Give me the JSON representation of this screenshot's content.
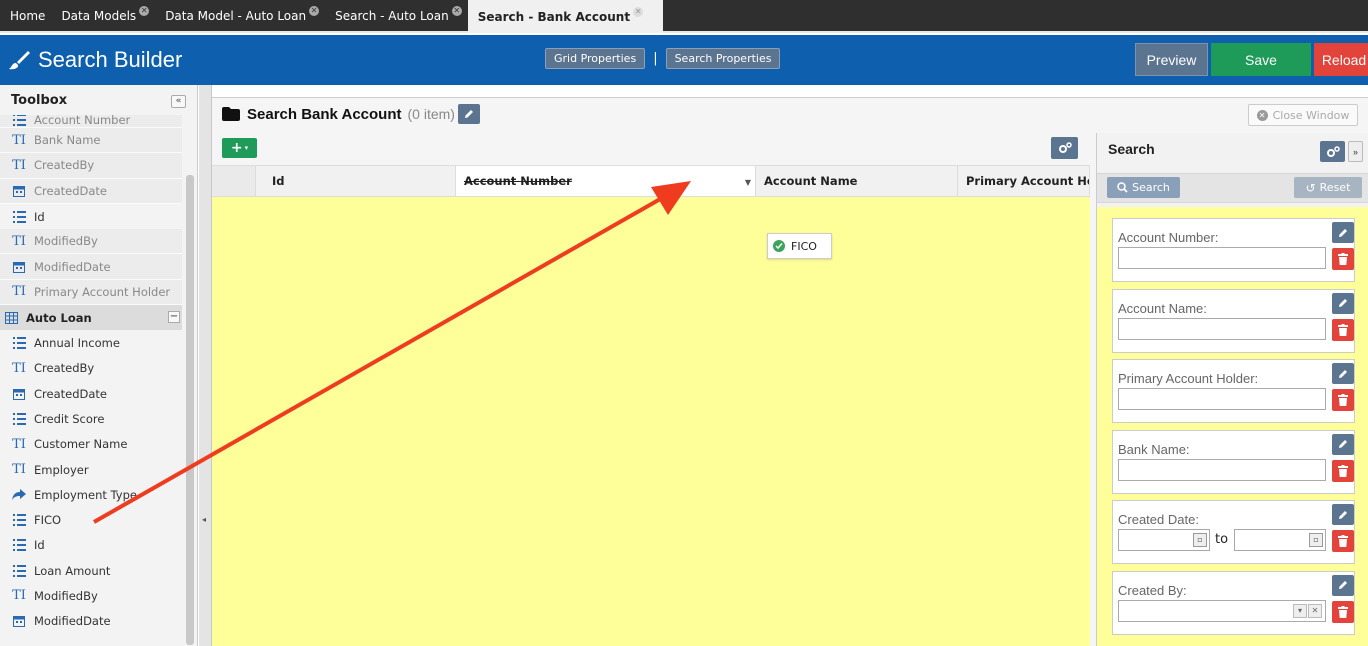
{
  "tabs": [
    {
      "label": "Home",
      "closable": false
    },
    {
      "label": "Data Models",
      "closable": true
    },
    {
      "label": "Data Model - Auto Loan",
      "closable": true
    },
    {
      "label": "Search - Auto Loan",
      "closable": true
    },
    {
      "label": "Search - Bank Account",
      "closable": true,
      "active": true
    }
  ],
  "header": {
    "title": "Search Builder",
    "grid_properties": "Grid Properties",
    "separator": "|",
    "search_properties": "Search Properties",
    "preview": "Preview",
    "save": "Save",
    "reload": "Reload"
  },
  "toolbox": {
    "title": "Toolbox",
    "collapse": "«",
    "items": [
      {
        "label": "Account Number",
        "icon": "list-icon",
        "dim": true
      },
      {
        "label": "Bank Name",
        "icon": "text-icon",
        "dim": true
      },
      {
        "label": "CreatedBy",
        "icon": "text-icon",
        "dim": true
      },
      {
        "label": "CreatedDate",
        "icon": "calendar-icon",
        "dim": true
      },
      {
        "label": "Id",
        "icon": "list-icon",
        "dim": false
      },
      {
        "label": "ModifiedBy",
        "icon": "text-icon",
        "dim": true
      },
      {
        "label": "ModifiedDate",
        "icon": "calendar-icon",
        "dim": true
      },
      {
        "label": "Primary Account Holder",
        "icon": "text-icon",
        "dim": true
      }
    ],
    "group": {
      "label": "Auto Loan",
      "icon": "table-icon",
      "toggle": "−"
    },
    "group_items": [
      {
        "label": "Annual Income",
        "icon": "list-icon"
      },
      {
        "label": "CreatedBy",
        "icon": "text-icon"
      },
      {
        "label": "CreatedDate",
        "icon": "calendar-icon"
      },
      {
        "label": "Credit Score",
        "icon": "list-icon"
      },
      {
        "label": "Customer Name",
        "icon": "text-icon"
      },
      {
        "label": "Employer",
        "icon": "text-icon"
      },
      {
        "label": "Employment Type",
        "icon": "share-icon"
      },
      {
        "label": "FICO",
        "icon": "list-icon"
      },
      {
        "label": "Id",
        "icon": "list-icon"
      },
      {
        "label": "Loan Amount",
        "icon": "list-icon"
      },
      {
        "label": "ModifiedBy",
        "icon": "text-icon"
      },
      {
        "label": "ModifiedDate",
        "icon": "calendar-icon"
      }
    ]
  },
  "main": {
    "title": "Search Bank Account",
    "count": "(0 item)",
    "close_window": "Close Window",
    "add_button": "+",
    "columns": [
      "Id",
      "Account Number",
      "Account Name",
      "Primary Account Ho"
    ],
    "drag_tooltip": "FICO"
  },
  "search_panel": {
    "title": "Search",
    "search_button": "Search",
    "reset_button": "Reset",
    "to_label": "to",
    "fields": [
      {
        "label": "Account Number:",
        "type": "text"
      },
      {
        "label": "Account Name:",
        "type": "text"
      },
      {
        "label": "Primary Account Holder:",
        "type": "text"
      },
      {
        "label": "Bank Name:",
        "type": "text"
      },
      {
        "label": "Created Date:",
        "type": "daterange"
      },
      {
        "label": "Created By:",
        "type": "select"
      }
    ]
  },
  "colors": {
    "header_blue": "#0e5fae",
    "save_green": "#1e9b58",
    "reload_red": "#e2433a",
    "grid_yellow": "#ffff99",
    "annotation_arrow": "#f03c1e"
  }
}
